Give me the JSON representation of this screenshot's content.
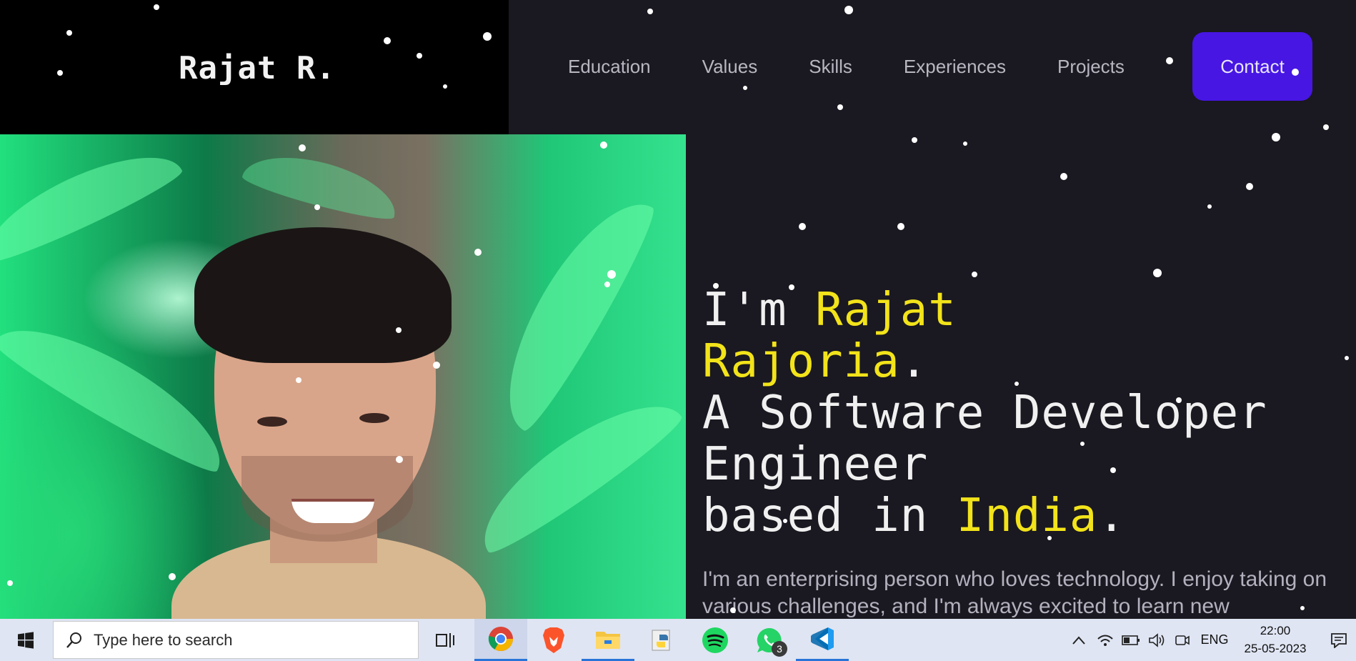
{
  "header": {
    "brand": "Rajat R.",
    "nav": [
      "Education",
      "Values",
      "Skills",
      "Experiences",
      "Projects"
    ],
    "contact_label": "Contact"
  },
  "hero": {
    "line1_prefix": "I'm ",
    "line1_name": "Rajat",
    "line2_name": "Rajoria",
    "line2_suffix": ".",
    "line3": "A Software Developer",
    "line4": "Engineer",
    "line5_prefix": "based in ",
    "line5_place": "India",
    "line5_suffix": ".",
    "description": "I'm an enterprising person who loves technology. I enjoy taking on various challenges, and I'm always excited to learn new"
  },
  "taskbar": {
    "search_placeholder": "Type here to search",
    "pinned": [
      "task-view-icon",
      "chrome-icon",
      "brave-icon",
      "file-explorer-icon",
      "python-icon",
      "spotify-icon",
      "whatsapp-icon",
      "vscode-icon"
    ],
    "whatsapp_badge": "3",
    "language": "ENG",
    "time": "22:00",
    "date": "25-05-2023"
  },
  "colors": {
    "accent": "#4716e3",
    "highlight": "#f2e31a",
    "background": "#1a1820",
    "brand_bg": "#000000"
  }
}
